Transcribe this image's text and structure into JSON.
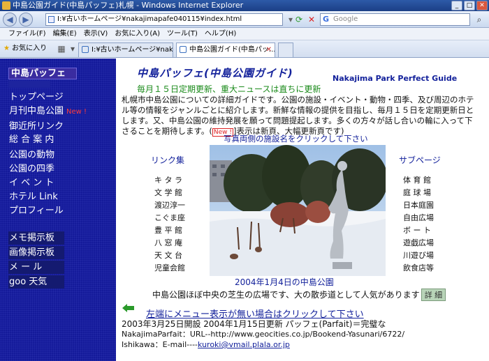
{
  "window": {
    "title": "中島公園ガイド(中島パッフェ)札幌 - Windows Internet Explorer"
  },
  "nav": {
    "back": "◀",
    "forward": "▶",
    "address": "I:¥古いホームページ¥nakajimapafe040115¥index.html",
    "search_placeholder": "Google",
    "search_logo": "G"
  },
  "menubar": [
    "ファイル(F)",
    "編集(E)",
    "表示(V)",
    "お気に入り(A)",
    "ツール(T)",
    "ヘルプ(H)"
  ],
  "tabbar": {
    "favorites": "お気に入り",
    "tabs": [
      {
        "label": "I:¥古いホームページ¥nakajim..."
      },
      {
        "label": "中島公園ガイド(中島パッ...",
        "close": "✕"
      }
    ]
  },
  "sidebar": {
    "logo": "中島パッフェ",
    "items": [
      {
        "label": "トップページ"
      },
      {
        "label": "月刊中島公園",
        "badge": "New !"
      },
      {
        "label": "御近所リンク"
      },
      {
        "label": "総 合 案 内"
      },
      {
        "label": "公園の動物"
      },
      {
        "label": "公園の四季"
      },
      {
        "label": "イ ベ ン ト"
      },
      {
        "label": "ホテル Link"
      },
      {
        "label": "プロフィール"
      },
      {
        "label": "メモ掲示板"
      },
      {
        "label": "画像掲示板"
      },
      {
        "label": "メ ー ル"
      },
      {
        "label": "goo  天気"
      }
    ]
  },
  "main": {
    "title": "中島パッフェ(中島公園ガイド)",
    "title_en": "Nakajima Park Perfect Guide",
    "update": "毎月１５日定期更新、重大ニュースは直ちに更新",
    "intro": "札幌市中島公園についての詳細ガイドです。公園の施設・イベント・動物・四季、及び周辺のホテル等の情報をジャンルごとに紹介します。新鮮な情報の提供を目指し、毎月１５日を定期更新日とします。又、中島公園の維持発展を願って問題提起します。多くの方々が話し合いの輪に入って下さることを期待します。(",
    "intro_new": "New !",
    "intro_tail": "]表示は新頁、大幅更新頁です)",
    "photo_note": "写真両側の施設名をクリックして下さい",
    "left_heading": "リンク集",
    "right_heading": "サブページ",
    "left_links": [
      "キ タ ラ",
      "文 学 館",
      "渡辺淳一",
      "こぐま座",
      "豊 平 館",
      "八 窓 庵",
      "天 文 台",
      "児童会館"
    ],
    "right_links": [
      "体 育 館",
      "庭 球 場",
      "日本庭園",
      "自由広場",
      "ボ ー ト",
      "遊戯広場",
      "川遊び場",
      "飲食店等"
    ],
    "caption": "2004年1月4日の中島公園",
    "desc": "中島公園ほぼ中央の芝生の広場です、大の散歩道として人気があります",
    "detail_button": "詳 細",
    "menu_link": "左端にメニュー表示が無い場合はクリックして下さい",
    "footer1": "2003年3月25日開設  2004年1月15日更新    パッフェ(Parfait)＝完璧な",
    "footer2": "NakajimaParfait：URL--http://www.geocities.co.jp/Bookend-Yasunari/6722/",
    "footer3_label": "Ishikawa：E-mail----",
    "footer3_email": "kuroki@vmail.plala.or.jp"
  },
  "colors": {
    "sidebar": "#141a9a",
    "heading": "#13219b",
    "update_text": "#1a8a1a",
    "new_badge": "#ff3b3b"
  }
}
